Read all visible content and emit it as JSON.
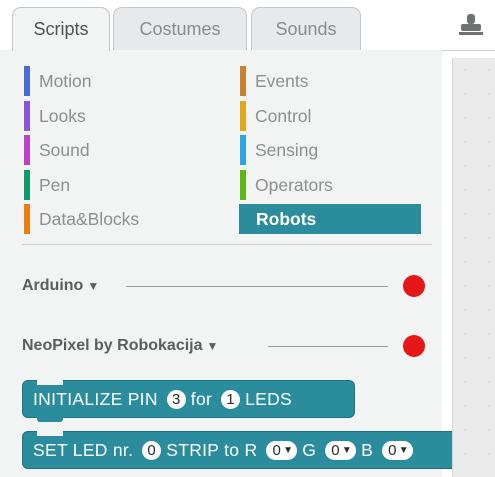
{
  "tabs": {
    "scripts": "Scripts",
    "costumes": "Costumes",
    "sounds": "Sounds"
  },
  "categories": {
    "motion": {
      "label": "Motion",
      "color": "#4a6cd4"
    },
    "looks": {
      "label": "Looks",
      "color": "#8a55d7"
    },
    "sound": {
      "label": "Sound",
      "color": "#bb42c3"
    },
    "pen": {
      "label": "Pen",
      "color": "#0e9a6c"
    },
    "data": {
      "label": "Data&Blocks",
      "color": "#ee7d16"
    },
    "events": {
      "label": "Events",
      "color": "#c88330"
    },
    "control": {
      "label": "Control",
      "color": "#e1a91a"
    },
    "sensing": {
      "label": "Sensing",
      "color": "#2ca5e2"
    },
    "operators": {
      "label": "Operators",
      "color": "#5cb712"
    },
    "robots": {
      "label": "Robots",
      "color": "#2a8c9c"
    }
  },
  "extensions": {
    "arduino": {
      "label": "Arduino",
      "status_color": "#e61717"
    },
    "neopixel": {
      "label": "NeoPixel by Robokacija",
      "status_color": "#e61717"
    }
  },
  "blocks": {
    "init": {
      "t1": "INITIALIZE PIN",
      "pin": "3",
      "t2": "for",
      "count": "1",
      "t3": "LEDS"
    },
    "setled": {
      "t1": "SET LED nr.",
      "nr": "0",
      "t2": "STRIP to R",
      "r": "0",
      "t3": "G",
      "g": "0",
      "t4": "B",
      "b": "0"
    }
  }
}
